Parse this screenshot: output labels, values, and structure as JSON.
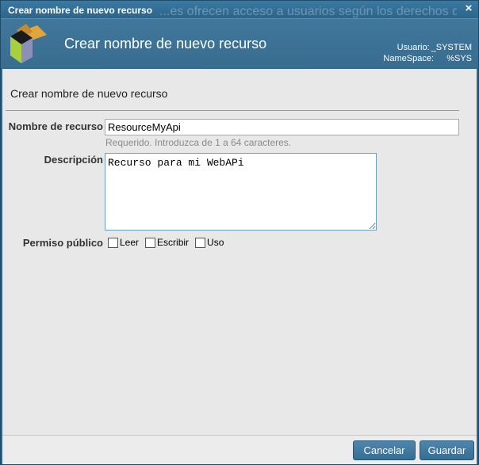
{
  "window": {
    "title": "Crear nombre de nuevo recurso",
    "background_text": "...es ofrecen acceso a usuarios según los derechos que tengan",
    "close_symbol": "×"
  },
  "header": {
    "heading": "Crear nombre de nuevo recurso",
    "user_label": "Usuario:",
    "user_value": "_SYSTEM",
    "namespace_label": "NameSpace:",
    "namespace_value": "%SYS",
    "logo_icon": "cube-icon"
  },
  "form": {
    "subtitle": "Crear nombre de nuevo recurso",
    "name_label": "Nombre de recurso",
    "name_value": "ResourceMyApi",
    "name_hint": "Requerido. Introduzca de 1 a 64 caracteres.",
    "description_label": "Descripción",
    "description_value": "Recurso para mi WebAPi",
    "permission_label": "Permiso público",
    "permissions": [
      {
        "label": "Leer",
        "checked": false
      },
      {
        "label": "Escribir",
        "checked": false
      },
      {
        "label": "Uso",
        "checked": false
      }
    ]
  },
  "footer": {
    "cancel_label": "Cancelar",
    "save_label": "Guardar"
  },
  "colors": {
    "titlebar": "#2f6689",
    "header": "#3a7095",
    "button": "#3f7aa2",
    "panel": "#e8e8e8"
  }
}
